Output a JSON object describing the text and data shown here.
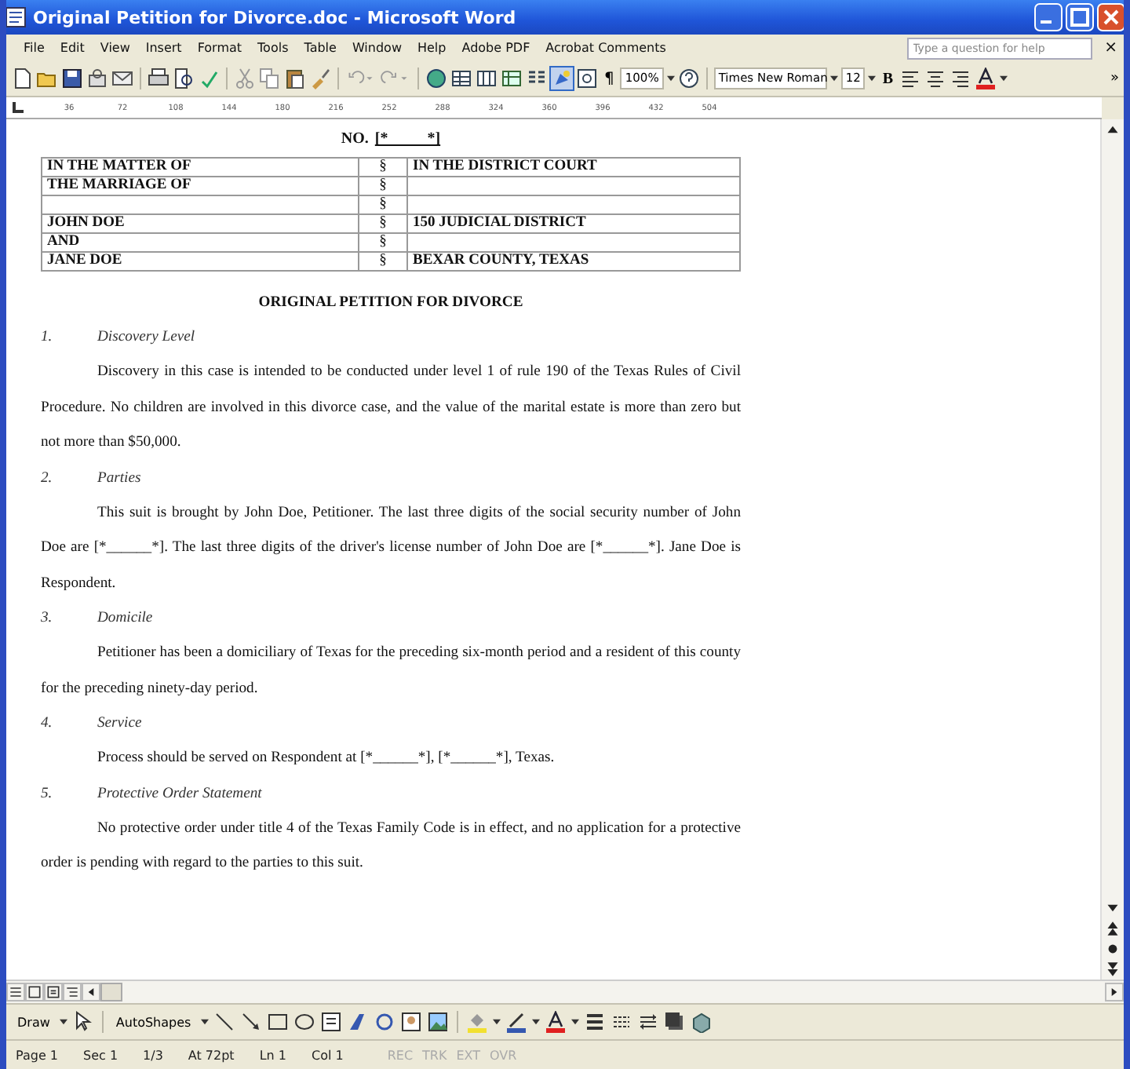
{
  "window": {
    "title": "Original Petition for Divorce.doc - Microsoft Word"
  },
  "menu": [
    "File",
    "Edit",
    "View",
    "Insert",
    "Format",
    "Tools",
    "Table",
    "Window",
    "Help",
    "Adobe PDF",
    "Acrobat Comments"
  ],
  "help_search": {
    "placeholder": "Type a question for help"
  },
  "close_document": "×",
  "toolbar": {
    "zoom": "100%",
    "paragraph_mark": "¶",
    "font": "Times New Roman",
    "size": "12",
    "bold": "B",
    "overflow": "»"
  },
  "ruler": {
    "ticks": [
      "36",
      "72",
      "108",
      "144",
      "180",
      "216",
      "252",
      "288",
      "324",
      "360",
      "396",
      "432",
      "504"
    ]
  },
  "document": {
    "case_number": {
      "label": "NO.",
      "value": "[*          *]"
    },
    "caption_rows": [
      {
        "left": "IN THE MATTER OF",
        "mark": "§",
        "right": "IN THE DISTRICT COURT"
      },
      {
        "left": "THE MARRIAGE OF",
        "mark": "§",
        "right": ""
      },
      {
        "left": "",
        "mark": "§",
        "right": ""
      },
      {
        "left": "JOHN DOE",
        "mark": "§",
        "right": "150 JUDICIAL DISTRICT"
      },
      {
        "left": "AND",
        "mark": "§",
        "right": ""
      },
      {
        "left": "JANE DOE",
        "mark": "§",
        "right": "BEXAR COUNTY, TEXAS"
      }
    ],
    "title": "ORIGINAL PETITION FOR DIVORCE",
    "sections": [
      {
        "number": "1.",
        "heading": "Discovery Level",
        "paragraphs": [
          "Discovery in this case is intended to be conducted under level 1 of rule 190 of the Texas Rules of Civil Procedure.  No children are involved in this divorce case, and the value of the marital estate is more than zero but not more than $50,000."
        ]
      },
      {
        "number": "2.",
        "heading": "Parties",
        "paragraphs": [
          "This suit is brought by John Doe, Petitioner.  The last three digits of the social security number of John Doe are [*______*].  The last three digits of the driver's license number of John Doe are [*______*].  Jane Doe is Respondent."
        ]
      },
      {
        "number": "3.",
        "heading": "Domicile",
        "paragraphs": [
          "Petitioner has been a domiciliary of Texas for the preceding six-month period and a resident of this county for the preceding ninety-day period."
        ]
      },
      {
        "number": "4.",
        "heading": "Service",
        "paragraphs": [
          "Process should be served on Respondent at [*______*], [*______*], Texas."
        ]
      },
      {
        "number": "5.",
        "heading": "Protective Order Statement",
        "paragraphs": [
          "No protective order under title 4 of the Texas Family Code is in effect, and no application for a protective order is pending with regard to the parties to this suit."
        ]
      }
    ]
  },
  "drawing_toolbar": {
    "draw": "Draw",
    "autoshapes": "AutoShapes"
  },
  "status_bar": [
    {
      "text": "Page 1",
      "disabled": false
    },
    {
      "text": "Sec 1",
      "disabled": false
    },
    {
      "text": "1/3",
      "disabled": false
    },
    {
      "text": "At 72pt",
      "disabled": false
    },
    {
      "text": "Ln 1",
      "disabled": false
    },
    {
      "text": "Col 1",
      "disabled": false
    },
    {
      "text": "REC",
      "disabled": true
    },
    {
      "text": "TRK",
      "disabled": true
    },
    {
      "text": "EXT",
      "disabled": true
    },
    {
      "text": "OVR",
      "disabled": true
    }
  ]
}
